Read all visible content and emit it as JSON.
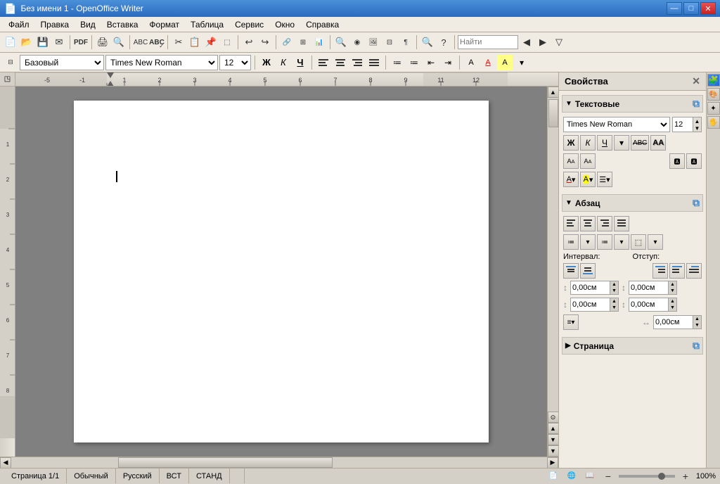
{
  "window": {
    "title": "Без имени 1 - OpenOffice Writer",
    "icon": "📄"
  },
  "titlebar": {
    "title": "Без имени 1 - OpenOffice Writer",
    "minimize": "—",
    "maximize": "□",
    "close": "✕"
  },
  "menubar": {
    "items": [
      "Файл",
      "Правка",
      "Вид",
      "Вставка",
      "Формат",
      "Таблица",
      "Сервис",
      "Окно",
      "Справка"
    ]
  },
  "toolbar": {
    "search_placeholder": "Найти"
  },
  "formatting": {
    "style": "Базовый",
    "font": "Times New Roman",
    "size": "12",
    "bold": "Ж",
    "italic": "К",
    "underline": "Ч"
  },
  "properties_panel": {
    "title": "Свойства",
    "close_btn": "✕",
    "sections": {
      "text": {
        "label": "Текстовые",
        "font": "Times New Roman",
        "size": "12",
        "format_btns": [
          "Ж",
          "К",
          "Ч",
          "▾",
          "АВС",
          "АА"
        ],
        "size_btns": [
          "АА",
          "АА"
        ],
        "color_btns": [
          "А▾",
          "А▾",
          "☰▾"
        ]
      },
      "paragraph": {
        "label": "Абзац",
        "align_btns": [
          "≡",
          "≡",
          "≡",
          "≡"
        ],
        "list_btns": [
          "≔▾",
          "≔▾",
          "⬚▾"
        ],
        "interval_label": "Интервал:",
        "indent_label": "Отступ:",
        "val1": "0,00см",
        "val2": "0,00см",
        "val3": "0,00см",
        "val4": "0,00см",
        "val5": "0,00см"
      },
      "page": {
        "label": "Страница"
      }
    }
  },
  "statusbar": {
    "page": "Страница 1/1",
    "style": "Обычный",
    "language": "Русский",
    "mode1": "ВСТ",
    "mode2": "СТАНД",
    "zoom": "100%"
  }
}
